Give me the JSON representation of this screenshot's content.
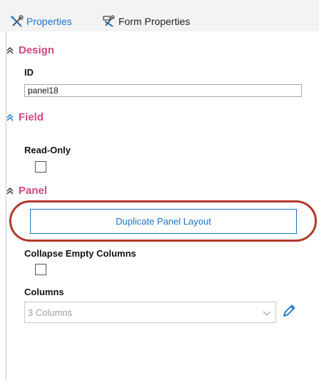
{
  "tabs": [
    {
      "label": "Properties",
      "icon": "tools-icon",
      "active": true
    },
    {
      "label": "Form Properties",
      "icon": "form-properties-icon",
      "active": false
    }
  ],
  "colors": {
    "accent": "#1a73c9",
    "section_title": "#d1477f",
    "highlight_ring": "#b03a2e"
  },
  "sections": {
    "design": {
      "title": "Design"
    },
    "field": {
      "title": "Field"
    },
    "panel": {
      "title": "Panel"
    }
  },
  "design": {
    "id_label": "ID",
    "id_value": "panel18"
  },
  "field": {
    "readonly_label": "Read-Only",
    "readonly_checked": false
  },
  "panel": {
    "duplicate_button_label": "Duplicate Panel Layout",
    "collapse_label": "Collapse Empty Columns",
    "collapse_checked": false,
    "columns_label": "Columns",
    "columns_value": "3 Columns"
  }
}
